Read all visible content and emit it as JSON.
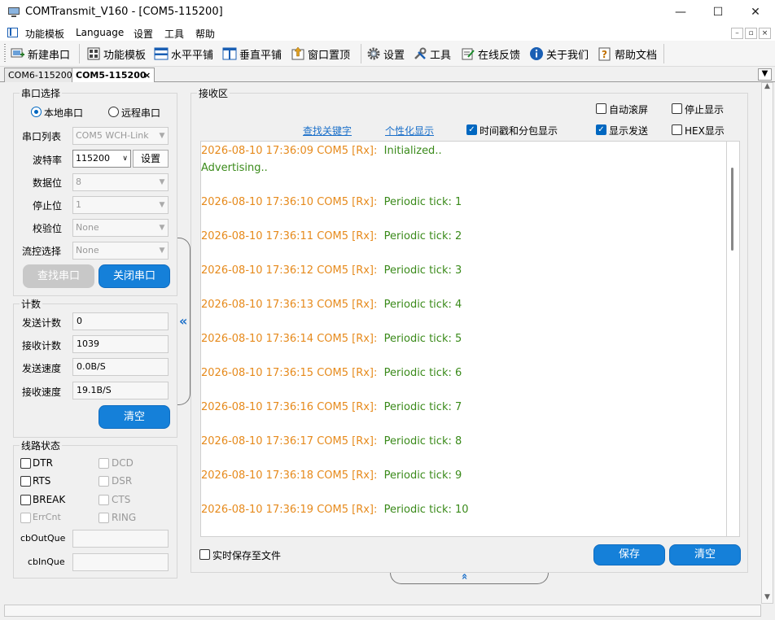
{
  "window": {
    "title": "COMTransmit_V160 - [COM5-115200]",
    "minimize": "—",
    "maximize": "☐",
    "close": "✕"
  },
  "menu": {
    "items": [
      "功能模板",
      "Language",
      "设置",
      "工具",
      "帮助"
    ],
    "mdi": [
      "–",
      "▫",
      "×"
    ]
  },
  "toolbar": {
    "items": [
      "新建串口",
      "功能模板",
      "水平平铺",
      "垂直平铺",
      "窗口置顶",
      "设置",
      "工具",
      "在线反馈",
      "关于我们",
      "帮助文档"
    ]
  },
  "tabs": {
    "items": [
      "COM6-115200",
      "COM5-115200"
    ],
    "close": "×",
    "menu": "▼"
  },
  "port": {
    "group_label": "串口选择",
    "local_label": "本地串口",
    "remote_label": "远程串口",
    "list_label": "串口列表",
    "list_value": "COM5   WCH-Link",
    "baud_label": "波特率",
    "baud_value": "115200",
    "set_button": "设置",
    "databits_label": "数据位",
    "databits_value": "8",
    "stopbits_label": "停止位",
    "stopbits_value": "1",
    "parity_label": "校验位",
    "parity_value": "None",
    "flow_label": "流控选择",
    "flow_value": "None",
    "find_button": "查找串口",
    "close_button": "关闭串口"
  },
  "count": {
    "group_label": "计数",
    "send_label": "发送计数",
    "send_value": "0",
    "recv_label": "接收计数",
    "recv_value": "1039",
    "send_speed_label": "发送速度",
    "send_speed_value": "0.0B/S",
    "recv_speed_label": "接收速度",
    "recv_speed_value": "19.1B/S",
    "clear_button": "清空"
  },
  "line_status": {
    "group_label": "线路状态",
    "dtr": "DTR",
    "dcd": "DCD",
    "rts": "RTS",
    "dsr": "DSR",
    "break": "BREAK",
    "cts": "CTS",
    "errcnt": "ErrCnt",
    "ring": "RING",
    "cbout_label": "cbOutQue",
    "cbin_label": "cbInQue"
  },
  "receive": {
    "group_label": "接收区",
    "auto_scroll": "自动滚屏",
    "stop_display": "停止显示",
    "find_keyword": "查找关键字",
    "personalize": "个性化显示",
    "timestamp_split": "时间戳和分包显示",
    "show_send": "显示发送",
    "hex_display": "HEX显示",
    "save_realtime": "实时保存至文件",
    "save_button": "保存",
    "clear_button": "清空",
    "lines": [
      {
        "ts": "2026-08-10 17:36:09 COM5 [Rx]:",
        "msg": "Initialized.."
      },
      {
        "ts": "",
        "msg": "Advertising.."
      },
      {
        "ts": "2026-08-10 17:36:10 COM5 [Rx]:",
        "msg": "Periodic tick: 1"
      },
      {
        "ts": "2026-08-10 17:36:11 COM5 [Rx]:",
        "msg": "Periodic tick: 2"
      },
      {
        "ts": "2026-08-10 17:36:12 COM5 [Rx]:",
        "msg": "Periodic tick: 3"
      },
      {
        "ts": "2026-08-10 17:36:13 COM5 [Rx]:",
        "msg": "Periodic tick: 4"
      },
      {
        "ts": "2026-08-10 17:36:14 COM5 [Rx]:",
        "msg": "Periodic tick: 5"
      },
      {
        "ts": "2026-08-10 17:36:15 COM5 [Rx]:",
        "msg": "Periodic tick: 6"
      },
      {
        "ts": "2026-08-10 17:36:16 COM5 [Rx]:",
        "msg": "Periodic tick: 7"
      },
      {
        "ts": "2026-08-10 17:36:17 COM5 [Rx]:",
        "msg": "Periodic tick: 8"
      },
      {
        "ts": "2026-08-10 17:36:18 COM5 [Rx]:",
        "msg": "Periodic tick: 9"
      },
      {
        "ts": "2026-08-10 17:36:19 COM5 [Rx]:",
        "msg": "Periodic tick: 10"
      }
    ]
  },
  "colors": {
    "accent": "#1580d9",
    "timestamp": "#e68a1c",
    "message": "#3a8a1a",
    "link": "#1a6fc9"
  }
}
